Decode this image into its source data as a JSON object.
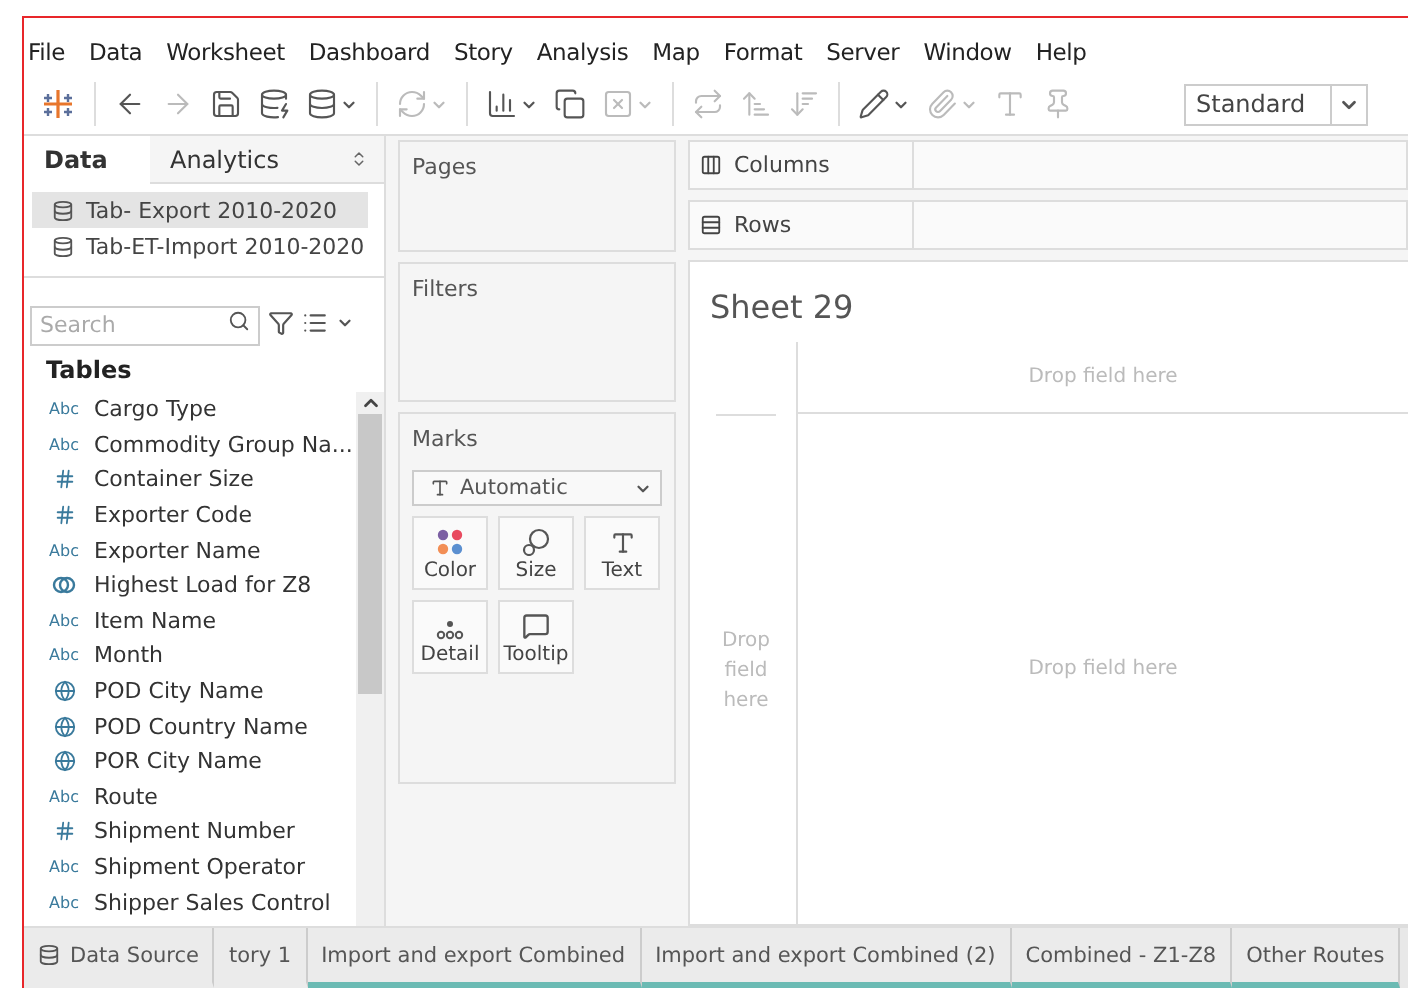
{
  "menu": [
    "File",
    "Data",
    "Worksheet",
    "Dashboard",
    "Story",
    "Analysis",
    "Map",
    "Format",
    "Server",
    "Window",
    "Help"
  ],
  "toolbar": [
    {
      "kind": "logo",
      "disabled": false,
      "dropdown": false
    },
    {
      "kind": "back",
      "disabled": false,
      "dropdown": false
    },
    {
      "kind": "forward",
      "disabled": true,
      "dropdown": false
    },
    {
      "kind": "save",
      "disabled": false,
      "dropdown": false
    },
    {
      "kind": "new-source",
      "disabled": false,
      "dropdown": false
    },
    {
      "kind": "pause",
      "disabled": false,
      "dropdown": true
    },
    {
      "kind": "refresh",
      "disabled": true,
      "dropdown": true
    },
    {
      "kind": "new-sheet",
      "disabled": false,
      "dropdown": true
    },
    {
      "kind": "duplicate",
      "disabled": false,
      "dropdown": false
    },
    {
      "kind": "clear",
      "disabled": true,
      "dropdown": true
    },
    {
      "kind": "swap",
      "disabled": true,
      "dropdown": false
    },
    {
      "kind": "sort-asc",
      "disabled": true,
      "dropdown": false
    },
    {
      "kind": "sort-desc",
      "disabled": true,
      "dropdown": false
    },
    {
      "kind": "highlight",
      "disabled": false,
      "dropdown": true
    },
    {
      "kind": "attach",
      "disabled": true,
      "dropdown": true
    },
    {
      "kind": "label",
      "disabled": true,
      "dropdown": false
    },
    {
      "kind": "pin",
      "disabled": true,
      "dropdown": false
    }
  ],
  "fit": {
    "value": "Standard"
  },
  "pane_tabs": [
    {
      "label": "Data",
      "selected": true
    },
    {
      "label": "Analytics",
      "selected": false
    }
  ],
  "data_sources": [
    {
      "name": "Tab- Export 2010-2020",
      "selected": true
    },
    {
      "name": "Tab-ET-Import 2010-2020",
      "selected": false
    }
  ],
  "search": {
    "placeholder": "Search"
  },
  "tables_heading": "Tables",
  "fields": [
    {
      "kind": "text",
      "badge": "Abc",
      "name": "Cargo Type"
    },
    {
      "kind": "text",
      "badge": "Abc",
      "name": "Commodity Group Na..."
    },
    {
      "kind": "number",
      "name": "Container Size"
    },
    {
      "kind": "number",
      "name": "Exporter Code"
    },
    {
      "kind": "text",
      "badge": "Abc",
      "name": "Exporter Name"
    },
    {
      "kind": "group",
      "name": "Highest Load for Z8"
    },
    {
      "kind": "text",
      "badge": "Abc",
      "name": "Item Name"
    },
    {
      "kind": "text",
      "badge": "Abc",
      "name": "Month"
    },
    {
      "kind": "geo",
      "name": "POD City Name"
    },
    {
      "kind": "geo",
      "name": "POD Country Name"
    },
    {
      "kind": "geo",
      "name": "POR City Name"
    },
    {
      "kind": "text",
      "badge": "Abc",
      "name": "Route"
    },
    {
      "kind": "number",
      "name": "Shipment Number"
    },
    {
      "kind": "text",
      "badge": "Abc",
      "name": "Shipment Operator"
    },
    {
      "kind": "text",
      "badge": "Abc",
      "name": "Shipper Sales Control"
    }
  ],
  "cards": {
    "pages": "Pages",
    "filters": "Filters",
    "marks": "Marks"
  },
  "mark_type": "Automatic",
  "mark_buttons": [
    {
      "kind": "color",
      "label": "Color"
    },
    {
      "kind": "size",
      "label": "Size"
    },
    {
      "kind": "text",
      "label": "Text"
    },
    {
      "kind": "detail",
      "label": "Detail"
    },
    {
      "kind": "tooltip",
      "label": "Tooltip"
    }
  ],
  "shelves": [
    {
      "kind": "columns",
      "label": "Columns"
    },
    {
      "kind": "rows",
      "label": "Rows"
    }
  ],
  "sheet": {
    "title": "Sheet 29",
    "drop_top": "Drop field here",
    "drop_left": "Drop field here",
    "drop_main": "Drop field here"
  },
  "sheet_tabs": [
    {
      "kind": "source",
      "label": "Data Source"
    },
    {
      "kind": "sheet",
      "label": "tory 1"
    },
    {
      "kind": "dashboard",
      "label": "Import and export Combined"
    },
    {
      "kind": "dashboard",
      "label": "Import and export Combined (2)"
    },
    {
      "kind": "dashboard",
      "label": "Combined - Z1-Z8"
    },
    {
      "kind": "dashboard",
      "label": "Other Routes"
    }
  ]
}
